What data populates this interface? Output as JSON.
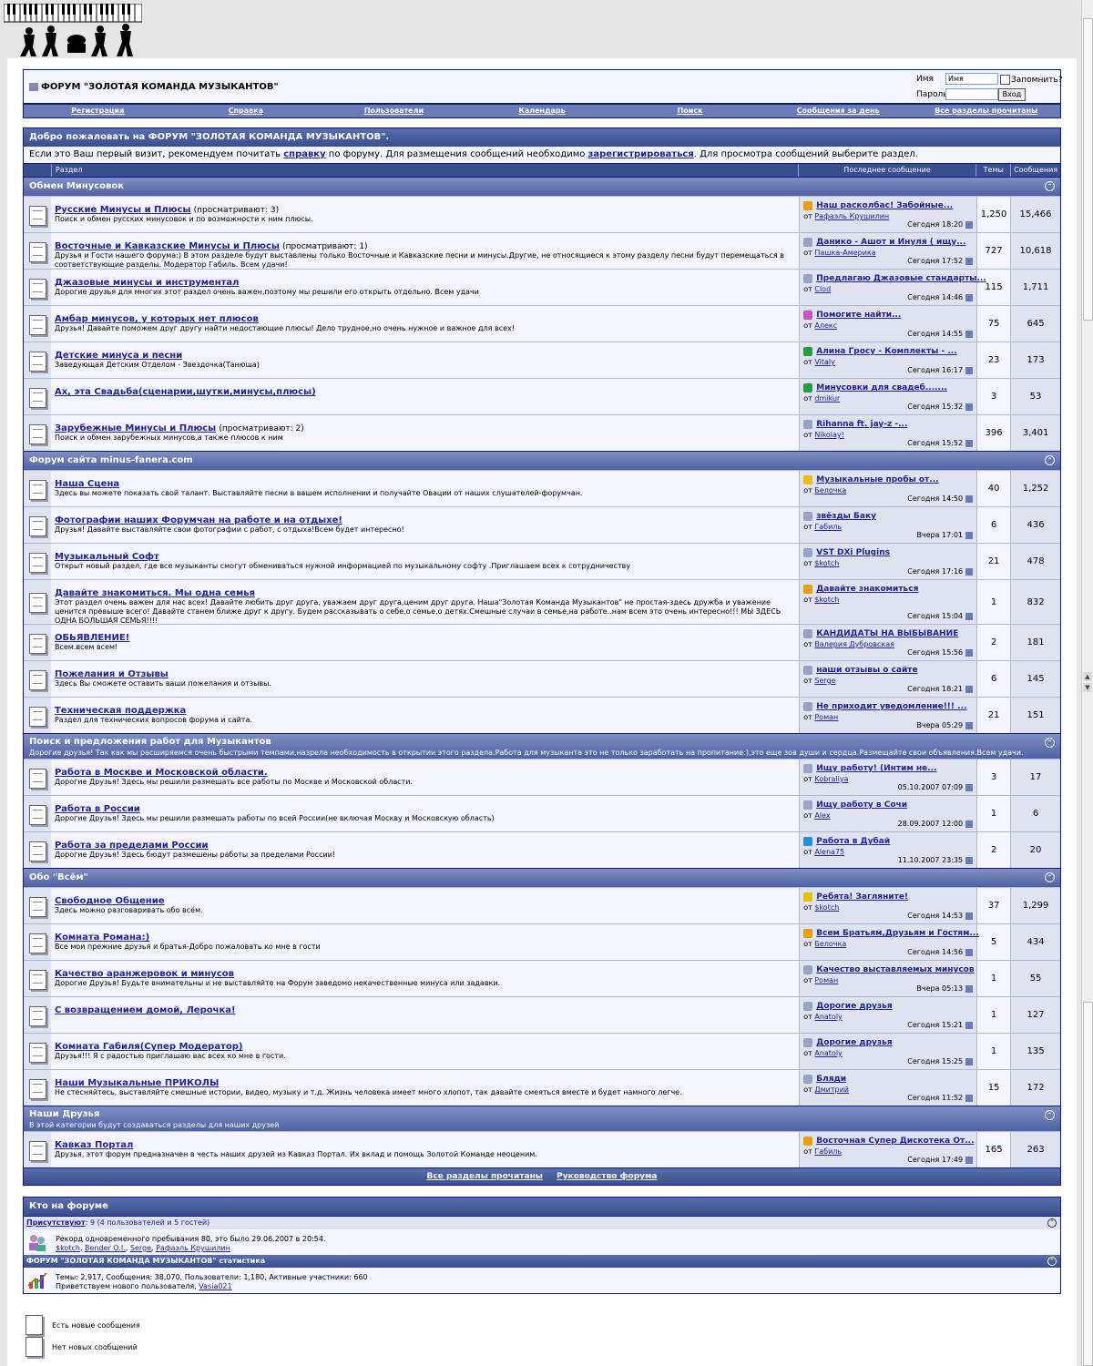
{
  "site": {
    "title": "ФОРУМ \"ЗОЛОТАЯ КОМАНДА МУЗЫКАНТОВ\"",
    "login": {
      "name_label": "Имя",
      "name_value": "Имя",
      "remember_label": "Запомнить?",
      "password_label": "Пароль",
      "login_button": "Вход"
    }
  },
  "navbar": [
    "Регистрация",
    "Справка",
    "Пользователи",
    "Календарь",
    "Поиск",
    "Сообщения за день",
    "Все разделы прочитаны"
  ],
  "welcome": {
    "title": "Добро пожаловать на ФОРУМ \"ЗОЛОТАЯ КОМАНДА МУЗЫКАНТОВ\".",
    "text_1": "Если это Ваш первый визит, рекомендуем почитать ",
    "link_help": "справку",
    "text_2": " по форуму. Для размещения сообщений необходимо ",
    "link_register": "зарегистрироваться",
    "text_3": ". Для просмотра сообщений выберите раздел."
  },
  "columns": {
    "section": "Раздел",
    "last_post": "Последнее сообщение",
    "threads": "Темы",
    "posts": "Сообщения"
  },
  "categories": [
    {
      "title": "Обмен Минусовок",
      "desc": "",
      "forums": [
        {
          "name": "Русские Минусы и Плюсы",
          "viewing": "(просматривают: 3)",
          "desc": "Поиск и обмен русских минусовок и по возможности к ним плюсы.",
          "last_title": "Наш расколбас! Забойные...",
          "last_by_label": "от",
          "last_user": "Рафаэль Крушилин",
          "last_date": "Сегодня 18:20",
          "last_icon": "thumb",
          "threads": "1,250",
          "posts": "15,466",
          "h": 39
        },
        {
          "name": "Восточные и Кавказские Минусы и Плюсы",
          "viewing": "(просматривают: 1)",
          "desc": "Друзья и Гости нашего форума:) В этом разделе будут выставлены только Восточные и Кавказские песни и минусы.Другие, не относящиеся к этому разделу песни будут перемещаться в соответствующие разделы. Модератор Габиль. Всем удачи!",
          "last_title": "Данико - Ашот и Инуля ( ищу...",
          "last_by_label": "от",
          "last_user": "Пашка-Америка",
          "last_date": "Сегодня 17:52",
          "last_icon": "doc",
          "threads": "727",
          "posts": "10,618",
          "h": 39
        },
        {
          "name": "Джазовые минусы и инструментал",
          "viewing": "",
          "desc": "Дорогие друзья для многих этот раздел очень важен,поэтому мы решили его открыть отдельно. Всем удачи",
          "last_title": "Предлагаю Джазовые стандарты...",
          "last_by_label": "от",
          "last_user": "Clod",
          "last_date": "Сегодня 14:46",
          "last_icon": "doc",
          "threads": "115",
          "posts": "1,711",
          "h": 39
        },
        {
          "name": "Амбар минусов, у которых нет плюсов",
          "viewing": "",
          "desc": "Друзья! Давайте поможем друг другу найти недостающие плюсы! Дело трудное,но очень нужное и важное для всех!",
          "last_title": "Помогите найти...",
          "last_by_label": "от",
          "last_user": "Алекс",
          "last_date": "Сегодня 14:55",
          "last_icon": "pink",
          "threads": "75",
          "posts": "645",
          "h": 39
        },
        {
          "name": "Детские минуса и песни",
          "viewing": "",
          "desc": "Заведующая Детским Отделом - Звездочка(Танюша)",
          "last_title": "Алина Гросу - Комплекты - ...",
          "last_by_label": "от",
          "last_user": "Vitaly",
          "last_date": "Сегодня 16:17",
          "last_icon": "arrow",
          "threads": "23",
          "posts": "173",
          "h": 39
        },
        {
          "name": "Ах, эта Свадьба(сценарии,шутки,минусы,плюсы)",
          "viewing": "",
          "desc": "",
          "last_title": "Минусовки для свадеб.......",
          "last_by_label": "от",
          "last_user": "dmikur",
          "last_date": "Сегодня 15:32",
          "last_icon": "arrow",
          "threads": "3",
          "posts": "53",
          "h": 39
        },
        {
          "name": "Зарубежные Минусы и Плюсы",
          "viewing": "(просматривают: 2)",
          "desc": "Поиск и обмен зарубежных минусов,а также плюсов к ним",
          "last_title": "Rihanna ft. jay-z -...",
          "last_by_label": "от",
          "last_user": "Nikolay!",
          "last_date": "Сегодня 15:52",
          "last_icon": "doc",
          "threads": "396",
          "posts": "3,401",
          "h": 39
        }
      ]
    },
    {
      "title": "Форум сайта minus-fanera.com",
      "desc": "",
      "forums": [
        {
          "name": "Наша Сцена",
          "viewing": "",
          "desc": "Здесь вы можете показать свой талант. Выставляйте песни в вашем исполнении и получайте Овации от наших слушателей-форумчан.",
          "last_title": "Музыкальные пробы от...",
          "last_by_label": "от",
          "last_user": "Белочка",
          "last_date": "Сегодня 14:50",
          "last_icon": "smile",
          "threads": "40",
          "posts": "1,252",
          "h": 39
        },
        {
          "name": "Фотографии наших Форумчан на работе и на отдыхе!",
          "viewing": "",
          "desc": "Друзья! Давайте выставляйте свои фотографии с работ, с отдыха!Всем будет интересно!",
          "last_title": "звёзды Баку",
          "last_by_label": "от",
          "last_user": "Габиль",
          "last_date": "Вчера 17:01",
          "last_icon": "doc",
          "threads": "6",
          "posts": "436",
          "h": 39
        },
        {
          "name": "Музыкальный Софт",
          "viewing": "",
          "desc": "Открыт новый раздел, где все музыканты смогут обмениваться нужной информацией по музыкальному софту .Приглашаем всех к сотрудничеству",
          "last_title": "VST DXi Plugins",
          "last_by_label": "от",
          "last_user": "$kotch",
          "last_date": "Сегодня 17:16",
          "last_icon": "doc",
          "threads": "21",
          "posts": "478",
          "h": 39
        },
        {
          "name": "Давайте знакомиться. Мы одна семья",
          "viewing": "",
          "desc": "Этот раздел очень важен для нас всех! Давайте любить друг друга, уважаем друг друга,ценим друг друга. Наша\"Золотая Команда Музыкантов\" не простая-здесь дружба и уважение ценится превыше всего! Давайте станем ближе друг к другу. Будем рассказывать о себе,о семье,о детях.Смешные случаи в семье,на работе..нам всем это очень интересно!!! МЫ ЗДЕСЬ ОДНА БОЛЬШАЯ СЕМЬЯ!!!!",
          "last_title": "Давайте знакомиться",
          "last_by_label": "от",
          "last_user": "$kotch",
          "last_date": "Сегодня 15:04",
          "last_icon": "thumb",
          "threads": "1",
          "posts": "832",
          "h": 48
        },
        {
          "name": "ОБЬЯВЛЕНИЕ!",
          "viewing": "",
          "desc": "Всем.всем всем!",
          "last_title": "КАНДИДАТЫ НА ВЫБЫВАНИЕ",
          "last_by_label": "от",
          "last_user": "Валерия Дубровская",
          "last_date": "Сегодня 15:56",
          "last_icon": "doc",
          "threads": "2",
          "posts": "181",
          "h": 39
        },
        {
          "name": "Пожелания и Отзывы",
          "viewing": "",
          "desc": "Здесь Вы сможете оставить ваши пожелания и отзывы.",
          "last_title": "наши отзывы о сайте",
          "last_by_label": "от",
          "last_user": "Serge",
          "last_date": "Сегодня 18:21",
          "last_icon": "doc",
          "threads": "6",
          "posts": "145",
          "h": 39
        },
        {
          "name": "Техническая поддержка",
          "viewing": "",
          "desc": "Раздел для технических вопросов форума и сайта.",
          "last_title": "Не приходит уведомление!!! ...",
          "last_by_label": "от",
          "last_user": "Роман",
          "last_date": "Вчера 05:29",
          "last_icon": "doc",
          "threads": "21",
          "posts": "151",
          "h": 39
        }
      ]
    },
    {
      "title": "Поиск и предложения работ для Музыкантов",
      "desc": "Дорогие друзья! Так как мы расширяемся очень быстрыми темпами,назрела необходимость в открытии этого раздела.Работа для музыканта это не только заработать на пропитание:),это еще зов души и сердца.Размещайте свои объявления.Всем удачи.",
      "forums": [
        {
          "name": "Работа в Москве и Московской области.",
          "viewing": "",
          "desc": "Дорогие Друзья! Здесь мы решили размешать все работы по Москве и Московской области.",
          "last_title": "Ищу работу! (Интим не...",
          "last_by_label": "от",
          "last_user": "Kobraliya",
          "last_date": "05.10.2007 07:09",
          "last_icon": "doc",
          "threads": "3",
          "posts": "17",
          "h": 39
        },
        {
          "name": "Работа в России",
          "viewing": "",
          "desc": "Дорогие Друзья! Здесь мы решили размешать работы по всей России(не включая Москву и Московскую область)",
          "last_title": "Ищу работу в Сочи",
          "last_by_label": "от",
          "last_user": "Alex",
          "last_date": "28.09.2007 12:00",
          "last_icon": "doc",
          "threads": "1",
          "posts": "6",
          "h": 39
        },
        {
          "name": "Работа за пределами России",
          "viewing": "",
          "desc": "Дорогие Друзья! Здесь бюдут размешены работы за пределами России!",
          "last_title": "Работа в Дубай",
          "last_by_label": "от",
          "last_user": "Alena75",
          "last_date": "11.10.2007 23:35",
          "last_icon": "question",
          "threads": "2",
          "posts": "20",
          "h": 39
        }
      ]
    },
    {
      "title": "Обо \"Всём\"",
      "desc": "",
      "forums": [
        {
          "name": "Свободное Общение",
          "viewing": "",
          "desc": "Здесь можно разговаривать обо всём.",
          "last_title": "Ребята! Загляните!",
          "last_by_label": "от",
          "last_user": "$kotch",
          "last_date": "Сегодня 14:53",
          "last_icon": "smile",
          "threads": "37",
          "posts": "1,299",
          "h": 39
        },
        {
          "name": "Комната Романа:)",
          "viewing": "",
          "desc": "Все мои прежние друзья и братья-Добро пожаловать ко мне в гости",
          "last_title": "Всем Братьям,Друзьям и Гостям...",
          "last_by_label": "от",
          "last_user": "Белочка",
          "last_date": "Сегодня 14:56",
          "last_icon": "thumb",
          "threads": "5",
          "posts": "434",
          "h": 39
        },
        {
          "name": "Качество аранжеровок и минусов",
          "viewing": "",
          "desc": "Дорогие Друзья! Будьте внимательны и не выставляйте на Форум заведомо некачественные минуса или задавки.",
          "last_title": "Качество выставляемых минусов",
          "last_by_label": "от",
          "last_user": "Роман",
          "last_date": "Вчера 05:13",
          "last_icon": "doc",
          "threads": "1",
          "posts": "55",
          "h": 39
        },
        {
          "name": "С возвращением домой, Лерочка!",
          "viewing": "",
          "desc": "",
          "last_title": "Дорогие друзья",
          "last_by_label": "от",
          "last_user": "Anatoly",
          "last_date": "Сегодня 15:21",
          "last_icon": "doc",
          "threads": "1",
          "posts": "127",
          "h": 39
        },
        {
          "name": "Комната Габиля(Супер Модератор)",
          "viewing": "",
          "desc": "Друзья!!! Я с радостью приглашаю вас всех ко мне в гости.",
          "last_title": "Дорогие друзья",
          "last_by_label": "от",
          "last_user": "Anatoly",
          "last_date": "Сегодня 15:25",
          "last_icon": "doc",
          "threads": "1",
          "posts": "135",
          "h": 39
        },
        {
          "name": "Наши Музыкальные ПРИКОЛЫ",
          "viewing": "",
          "desc": "Не стесняйтесь, выставляйте смешные истории, видео, музыку и т.д. Жизнь человека имеет много хлопот, так давайте смеяться вместе и будет намного легче.",
          "last_title": "Бляди",
          "last_by_label": "от",
          "last_user": "Дмитрий",
          "last_date": "Сегодня 11:52",
          "last_icon": "doc",
          "threads": "15",
          "posts": "172",
          "h": 39
        }
      ]
    },
    {
      "title": "Наши Друзья",
      "desc": "В этой категории будут создаваться разделы для наших друзей",
      "forums": [
        {
          "name": "Кавказ Портал",
          "viewing": "",
          "desc": "Друзья, этот форум предназначен в честь наших друзей из Кавказ Портал. Их вклад и помощь Золотой Команде неоценим.",
          "last_title": "Восточная Супер Дискотека От...",
          "last_by_label": "от",
          "last_user": "Габиль",
          "last_date": "Сегодня 17:49",
          "last_icon": "thumb",
          "threads": "165",
          "posts": "263",
          "h": 39
        }
      ]
    }
  ],
  "footer_links": [
    "Все разделы прочитаны",
    "Руководство форума"
  ],
  "whos_online": {
    "title": "Кто на форуме",
    "present_label": "Присутствуют",
    "present_count": ": 9 (4 пользователей и 5 гостей)",
    "record": "Рекорд одновременного пребывания 80, это было 29.06.2007 в 20:54.",
    "users": [
      "$kotch",
      "Bender O.I.",
      "Serge",
      "Рафаэль Крушилин"
    ],
    "stats_title": "ФОРУМ \"ЗОЛОТАЯ КОМАНДА МУЗЫКАНТОВ\" статистика",
    "stats_text": "Темы: 2,917, Сообщения: 38,070, Пользователи: 1,180, Активные участники: 660",
    "newest_label": "Приветствуем нового пользователя, ",
    "newest_user": "Vasia021"
  },
  "legend": [
    "Есть новые сообщения",
    "Нет новых сообщений"
  ],
  "colors": {
    "border": "#0b198c",
    "header": "#3a4d8e",
    "row_light": "#f5f5ff",
    "row_alt": "#dfe3f0",
    "link": "#22229c"
  }
}
